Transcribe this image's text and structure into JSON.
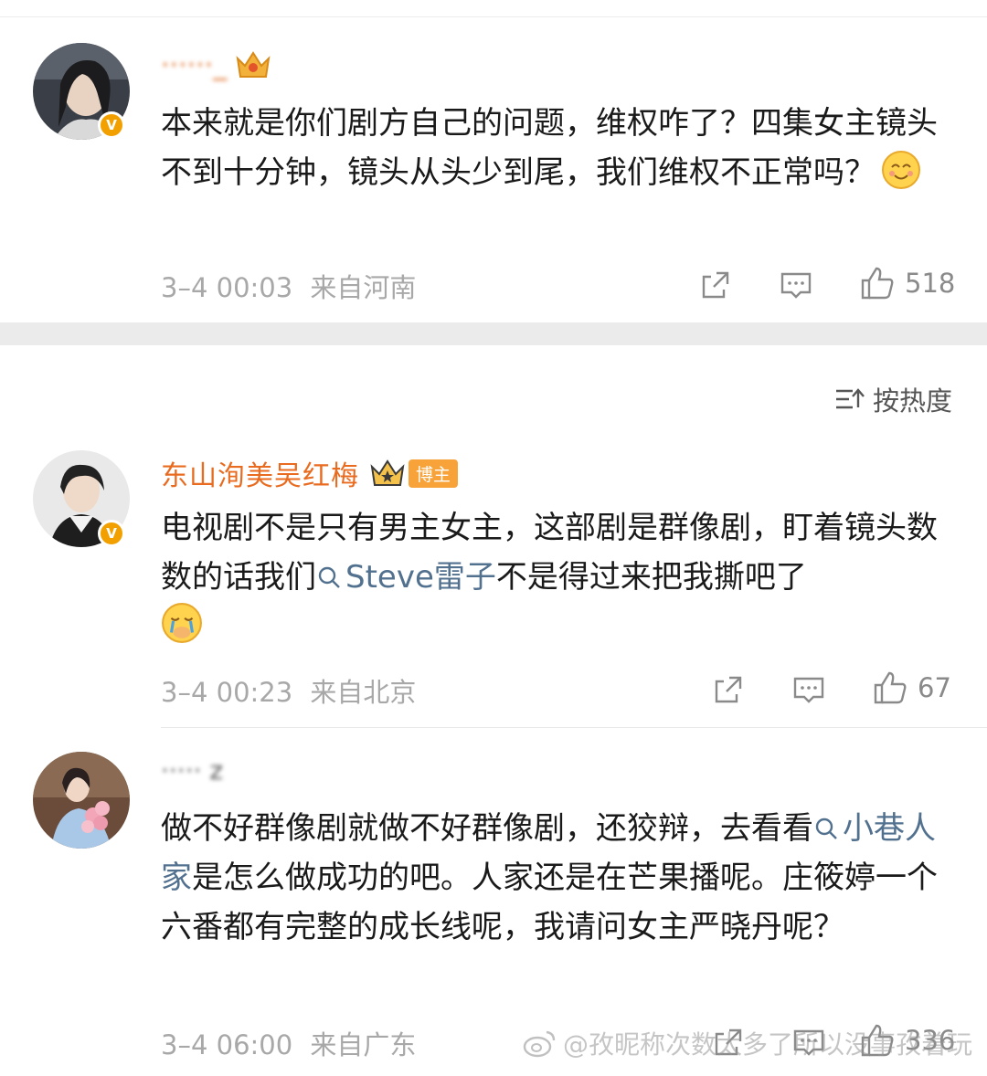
{
  "comments": [
    {
      "username": "······_",
      "text": "本来就是你们剧方自己的问题，维权咋了？四集女主镜头不到十分钟，镜头从头少到尾，我们维权不正常吗？",
      "emoji": "smile-emoji",
      "time": "3–4 00:03",
      "location": "来自河南",
      "likes": "518"
    },
    {
      "username": "东山洵美吴红梅",
      "badge": "博主",
      "text_before": "电视剧不是只有男主女主，这部剧是群像剧，盯着镜头数数的话我们",
      "topic": "Steve雷子",
      "text_after": "不是得过来把我撕吧了",
      "emoji": "cry-emoji",
      "time": "3–4 00:23",
      "location": "来自北京",
      "likes": "67"
    },
    {
      "username": "····· z",
      "text_before": "做不好群像剧就做不好群像剧，还狡辩，去看看",
      "topic": "小巷人家",
      "text_after": "是怎么做成功的吧。人家还是在芒果播呢。庄筱婷一个六番都有完整的成长线呢，我请问女主严晓丹呢？",
      "time": "3–4 06:00",
      "location": "来自广东",
      "likes": "336"
    }
  ],
  "sort_label": "按热度",
  "watermark": "@孜昵称次数太多了所以没事孜着玩",
  "colors": {
    "accent": "#e86b1f",
    "topic": "#52718f",
    "meta": "#a8a8a8",
    "verified": "#f2a000"
  }
}
